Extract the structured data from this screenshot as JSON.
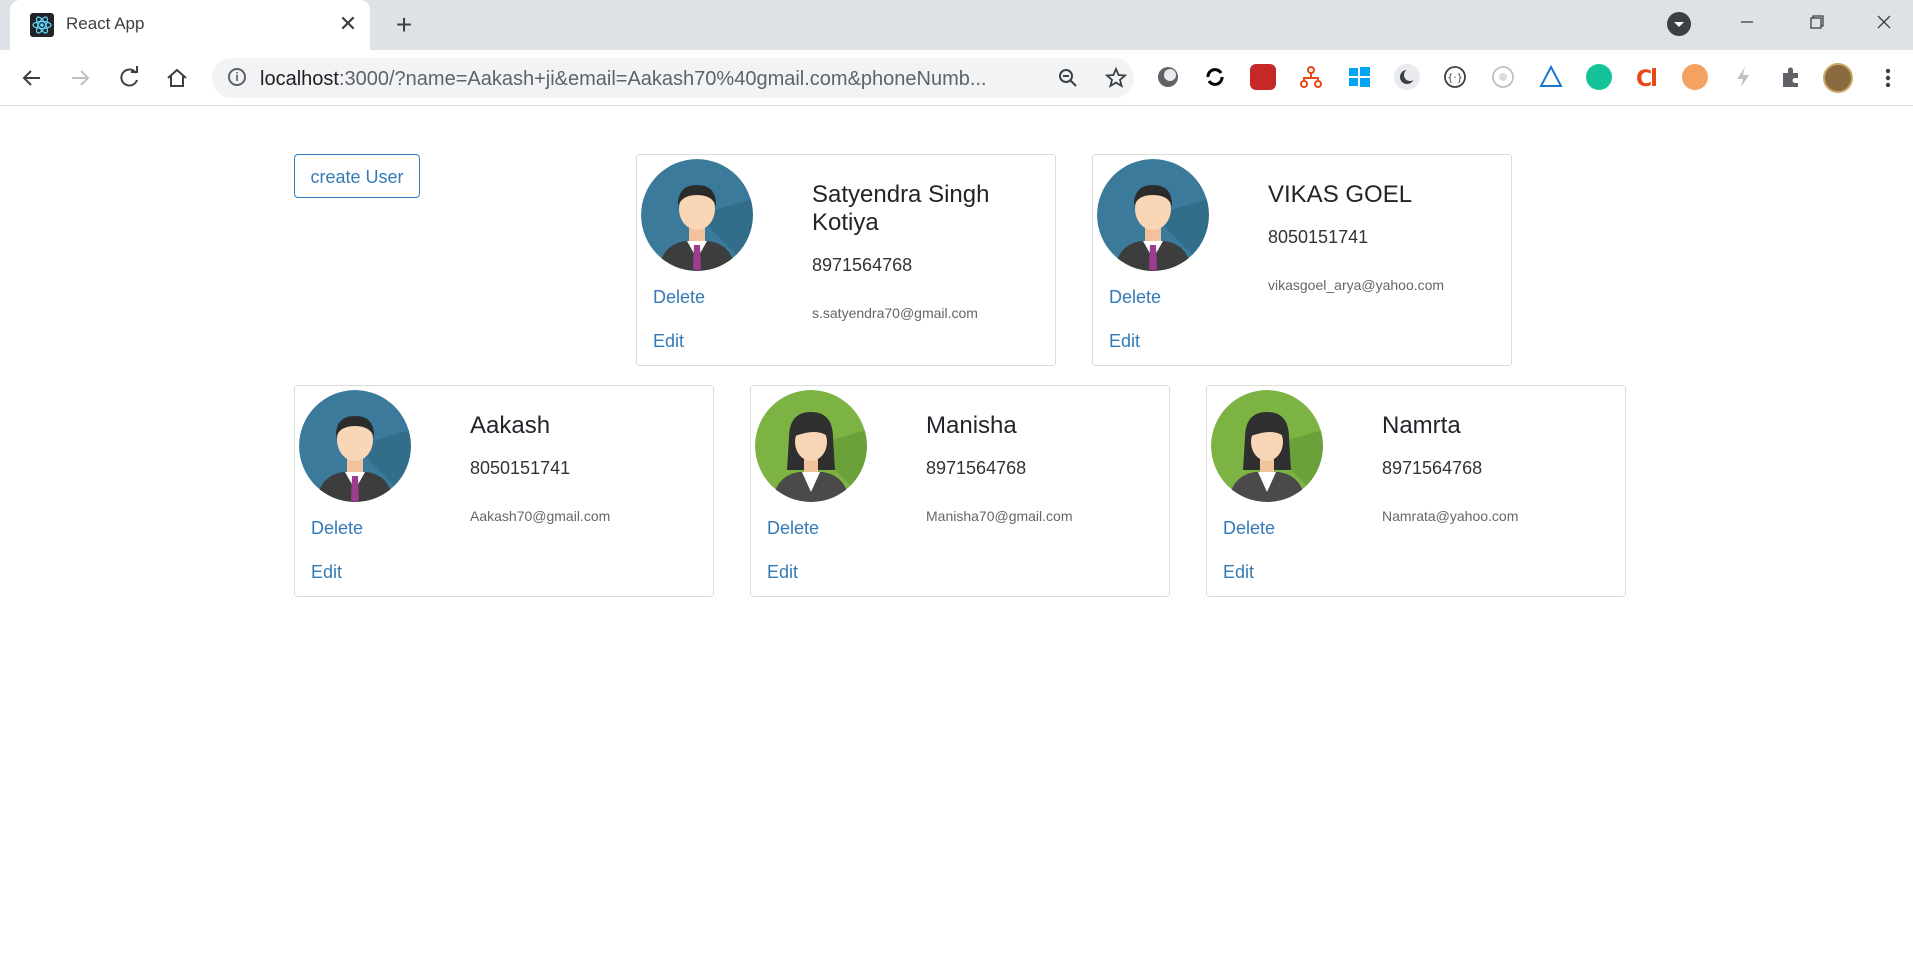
{
  "browser": {
    "tab_title": "React App",
    "url_host": "localhost",
    "url_rest": ":3000/?name=Aakash+ji&email=Aakash70%40gmail.com&phoneNumb...",
    "new_tab_glyph": "+",
    "close_glyph": "✕"
  },
  "page": {
    "create_button_label": "create User",
    "delete_label": "Delete",
    "edit_label": "Edit"
  },
  "users": [
    {
      "name": "Satyendra Singh Kotiya",
      "phone": "8971564768",
      "email": "s.satyendra70@gmail.com",
      "avatar": "male-avatar-icon"
    },
    {
      "name": "VIKAS GOEL",
      "phone": "8050151741",
      "email": "vikasgoel_arya@yahoo.com",
      "avatar": "male-avatar-icon"
    },
    {
      "name": "Aakash",
      "phone": "8050151741",
      "email": "Aakash70@gmail.com",
      "avatar": "male-avatar-icon"
    },
    {
      "name": "Manisha",
      "phone": "8971564768",
      "email": "Manisha70@gmail.com",
      "avatar": "female-avatar-icon"
    },
    {
      "name": "Namrta",
      "phone": "8971564768",
      "email": "Namrata@yahoo.com",
      "avatar": "female-avatar-icon"
    }
  ],
  "colors": {
    "link": "#337ab7",
    "male_avatar_bg": "#3b7a9a",
    "female_avatar_bg": "#7cb342"
  }
}
